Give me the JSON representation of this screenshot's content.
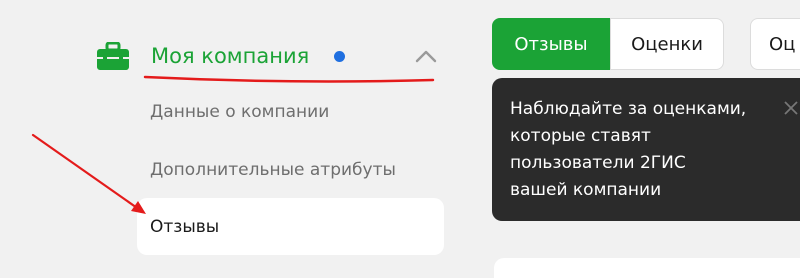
{
  "sidebar": {
    "company_title": "Моя компания",
    "items": [
      {
        "label": "Данные о компании"
      },
      {
        "label": "Дополнительные атрибуты"
      },
      {
        "label": "Отзывы"
      }
    ]
  },
  "tabs": [
    {
      "label": "Отзывы"
    },
    {
      "label": "Оценки"
    },
    {
      "label": "Оц"
    }
  ],
  "tooltip": {
    "lines": [
      "Наблюдайте за оценками,",
      "которые ставят",
      "пользователи 2ГИС",
      "вашей компании"
    ]
  },
  "colors": {
    "accent": "#1ba336",
    "annotation": "#e41b1b",
    "dot": "#1f6fe0",
    "tooltip_bg": "#2b2b2b"
  },
  "icons": {
    "company": "briefcase-icon",
    "collapse": "chevron-up-icon",
    "close": "close-icon"
  }
}
